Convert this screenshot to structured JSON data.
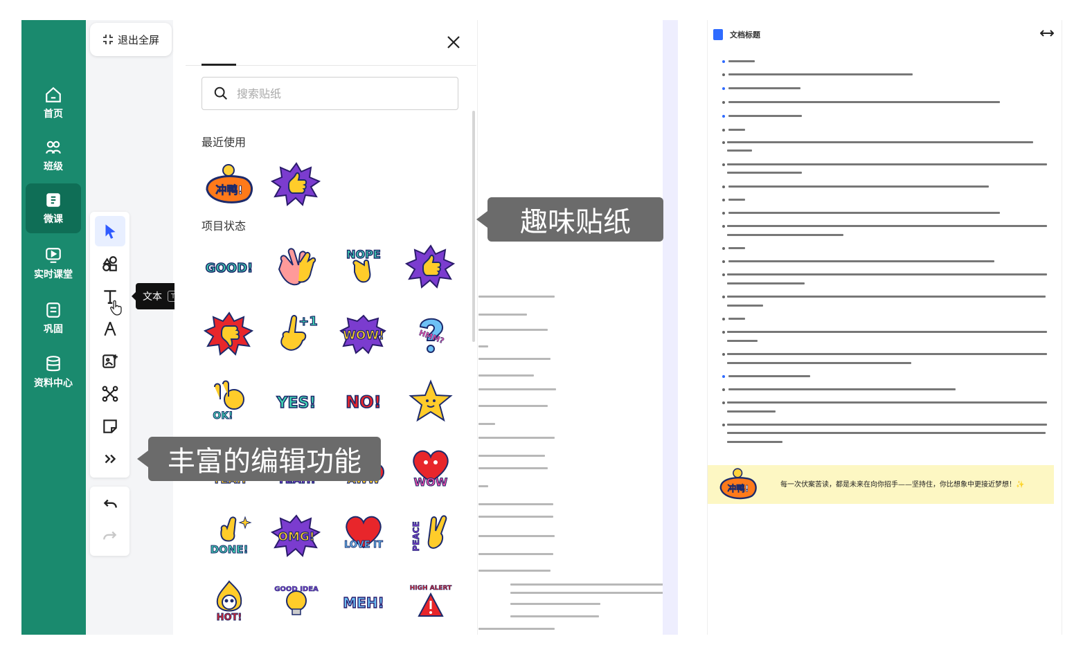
{
  "nav": {
    "items": [
      {
        "label": "首页",
        "icon": "home-icon"
      },
      {
        "label": "班级",
        "icon": "users-icon"
      },
      {
        "label": "微课",
        "icon": "micro-lesson-icon",
        "active": true
      },
      {
        "label": "实时课堂",
        "icon": "live-class-icon"
      },
      {
        "label": "巩固",
        "icon": "practice-icon"
      },
      {
        "label": "资料中心",
        "icon": "database-icon"
      }
    ],
    "accent": "#1a8a6e",
    "active_bg": "#0f6e56"
  },
  "toolbar": {
    "exit_fullscreen_label": "退出全屏",
    "tools": [
      "select-tool",
      "shapes-tool",
      "text-tool",
      "pen-tool",
      "image-tool",
      "connector-tool",
      "sticky-note-tool",
      "more-tools"
    ],
    "active_tool": "select-tool",
    "tooltip": {
      "label": "文本",
      "shortcut": "T"
    }
  },
  "sticker_panel": {
    "search_placeholder": "搜索贴纸",
    "section_recent": "最近使用",
    "section_status": "项目状态",
    "recent": [
      "冲鸭!",
      "thumbs-up"
    ],
    "status_stickers": [
      "GOOD!",
      "clapping-hands",
      "NOPE",
      "thumbs-up",
      "thumbs-down",
      "+1",
      "WOW!",
      "HMM?",
      "OK!",
      "YES!",
      "NO!",
      "star",
      "YEAH",
      "YEAH!",
      "AWW",
      "WOW",
      "DONE!",
      "OMG!",
      "LOVE IT",
      "PEACE",
      "HOT!",
      "GOOD IDEA",
      "MEH!",
      "HIGH ALERT"
    ]
  },
  "callouts": {
    "stickers": "趣味贴纸",
    "editing": "丰富的编辑功能"
  },
  "document": {
    "title": "文档标题",
    "banner_sticker": "冲鸭!",
    "banner_text": "每一次伏案苦读，都是未来在向你招手——坚持住，你比想象中更接近梦想！✨"
  }
}
